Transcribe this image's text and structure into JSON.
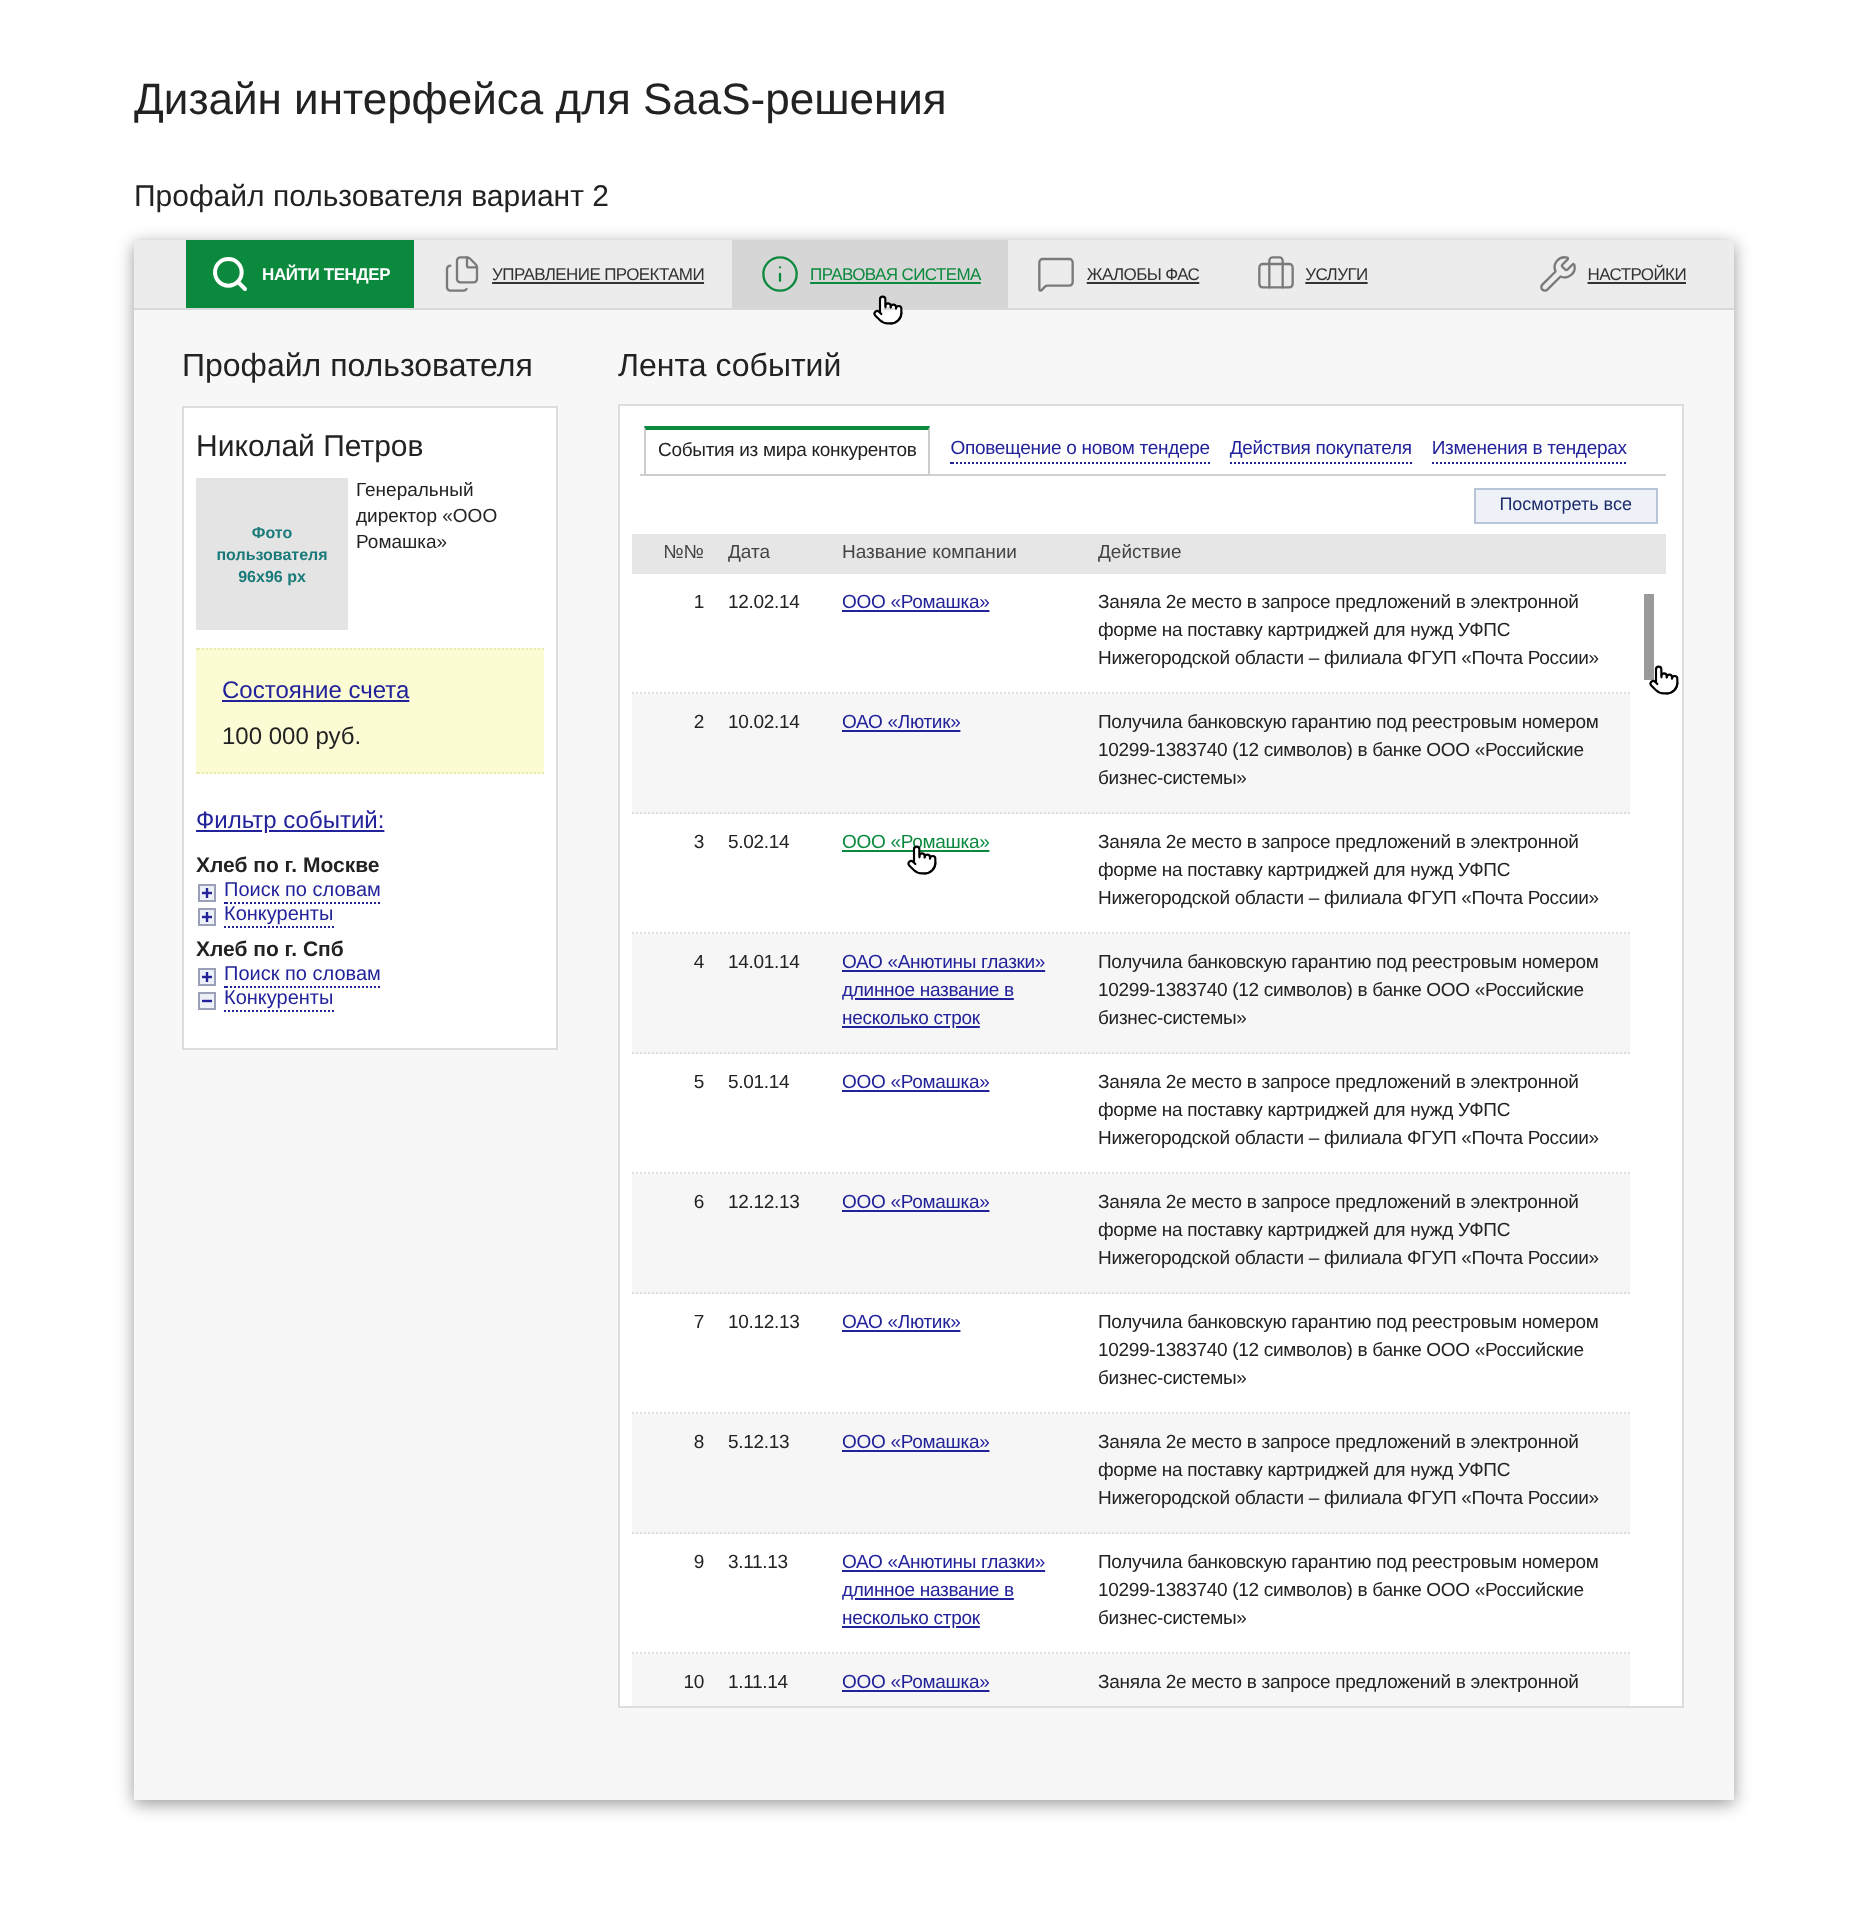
{
  "page": {
    "title": "Дизайн интерфейса для SaaS-решения",
    "subtitle": "Профайл пользователя вариант 2"
  },
  "nav": {
    "items": [
      {
        "label": "НАЙТИ ТЕНДЕР",
        "kind": "primary",
        "selected": false,
        "hovered": false
      },
      {
        "label": "УПРАВЛЕНИЕ ПРОЕКТАМИ",
        "kind": "link",
        "selected": false,
        "hovered": false
      },
      {
        "label": "ПРАВОВАЯ СИСТЕМА",
        "kind": "link",
        "selected": true,
        "hovered": true
      },
      {
        "label": "ЖАЛОБЫ ФАС",
        "kind": "link",
        "selected": false,
        "hovered": false
      },
      {
        "label": "УСЛУГИ",
        "kind": "link",
        "selected": false,
        "hovered": false
      },
      {
        "label": "НАСТРОЙКИ",
        "kind": "aside",
        "selected": false,
        "hovered": false
      }
    ]
  },
  "profile": {
    "heading": "Профайл пользователя",
    "name": "Николай Петров",
    "photo_label": "Фото пользователя 96x96 px",
    "position": "Генеральный директор «ООО Ромашка»",
    "account": {
      "label": "Состояние счета",
      "value": "100 000 руб."
    },
    "filter": {
      "label": "Фильтр событий:",
      "groups": [
        {
          "title": "Хлеб по г. Москве",
          "items": [
            {
              "label": "Поиск по словам",
              "expanded": false
            },
            {
              "label": "Конкуренты",
              "expanded": false
            }
          ]
        },
        {
          "title": "Хлеб по г. Спб",
          "items": [
            {
              "label": "Поиск по словам",
              "expanded": false
            },
            {
              "label": "Конкуренты",
              "expanded": true
            }
          ]
        }
      ]
    }
  },
  "feed": {
    "heading": "Лента событий",
    "tabs": [
      {
        "label": "События из мира конкурентов",
        "selected": true
      },
      {
        "label": "Оповещение о новом тендере",
        "selected": false
      },
      {
        "label": "Действия покупателя",
        "selected": false
      },
      {
        "label": "Изменения в тендерах",
        "selected": false
      }
    ],
    "view_all": "Посмотреть все",
    "table": {
      "columns": [
        "№№",
        "Дата",
        "Название компании",
        "Действие"
      ],
      "rows": [
        {
          "number": "1",
          "date": "12.02.14",
          "company": "ООО «Ромашка»",
          "hovered": false,
          "action": "Заняла 2е место в запросе предложений в электронной форме на поставку картриджей для нужд УФПС Нижегородской области – филиала ФГУП «Почта России»"
        },
        {
          "number": "2",
          "date": "10.02.14",
          "company": "ОАО «Лютик»",
          "hovered": false,
          "action": "Получила банковскую гарантию под реестровым номером 10299-1383740 (12 символов) в банке ООО «Российские бизнес-системы»"
        },
        {
          "number": "3",
          "date": "5.02.14",
          "company": "ООО «Ромашка»",
          "hovered": true,
          "action": "Заняла 2е место в запросе предложений в электронной форме на поставку картриджей для нужд УФПС Нижегородской области – филиала ФГУП «Почта России»"
        },
        {
          "number": "4",
          "date": "14.01.14",
          "company": "ОАО «Анютины глазки» длинное название в несколько строк",
          "hovered": false,
          "action": "Получила банковскую гарантию под реестровым номером 10299-1383740 (12 символов) в банке ООО «Российские бизнес-системы»"
        },
        {
          "number": "5",
          "date": "5.01.14",
          "company": "ООО «Ромашка»",
          "hovered": false,
          "action": "Заняла 2е место в запросе предложений в электронной форме на поставку картриджей для нужд УФПС Нижегородской области – филиала ФГУП «Почта России»"
        },
        {
          "number": "6",
          "date": "12.12.13",
          "company": "ООО «Ромашка»",
          "hovered": false,
          "action": "Заняла 2е место в запросе предложений в электронной форме на поставку картриджей для нужд УФПС Нижегородской области – филиала ФГУП «Почта России»"
        },
        {
          "number": "7",
          "date": "10.12.13",
          "company": "ОАО «Лютик»",
          "hovered": false,
          "action": "Получила банковскую гарантию под реестровым номером 10299-1383740 (12 символов) в банке ООО «Российские бизнес-системы»"
        },
        {
          "number": "8",
          "date": "5.12.13",
          "company": "ООО «Ромашка»",
          "hovered": false,
          "action": "Заняла 2е место в запросе предложений в электронной форме на поставку картриджей для нужд УФПС Нижегородской области – филиала ФГУП «Почта России»"
        },
        {
          "number": "9",
          "date": "3.11.13",
          "company": "ОАО «Анютины глазки» длинное название в несколько строк",
          "hovered": false,
          "action": "Получила банковскую гарантию под реестровым номером 10299-1383740 (12 символов) в банке ООО «Российские бизнес-системы»"
        },
        {
          "number": "10",
          "date": "1.11.14",
          "company": "ООО «Ромашка»",
          "hovered": false,
          "action": "Заняла 2е место в запросе предложений в электронной"
        }
      ]
    },
    "scrollbar": {
      "hovered": true
    }
  }
}
